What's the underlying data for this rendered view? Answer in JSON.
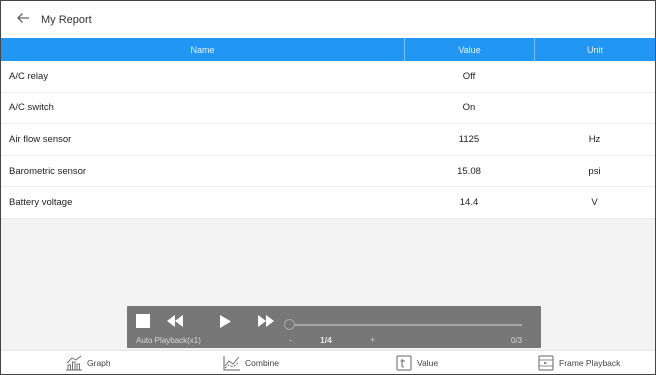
{
  "header": {
    "title": "My Report",
    "back_icon": "arrow-left-icon"
  },
  "table": {
    "columns": {
      "name": "Name",
      "value": "Value",
      "unit": "Unit"
    },
    "rows": [
      {
        "name": "A/C relay",
        "value": "Off",
        "unit": ""
      },
      {
        "name": "A/C switch",
        "value": "On",
        "unit": ""
      },
      {
        "name": "Air flow sensor",
        "value": "1125",
        "unit": "Hz"
      },
      {
        "name": "Barometric sensor",
        "value": "15.08",
        "unit": "psi"
      },
      {
        "name": "Battery voltage",
        "value": "14.4",
        "unit": "V"
      }
    ]
  },
  "player": {
    "auto_playback": "Auto Playback(x1)",
    "prev_page": "-",
    "next_page": "+",
    "page_indicator": "1/4",
    "frame_count": "0/3",
    "progress": 0,
    "icons": [
      "stop-icon",
      "rewind-icon",
      "play-icon",
      "fast-forward-icon"
    ]
  },
  "toolbar": {
    "graph": "Graph",
    "combine": "Combine",
    "value": "Value",
    "frame_playback": "Frame Playback"
  },
  "colors": {
    "header_blue": "#2196f3",
    "player_gray": "#777777",
    "background": "#f3f3f3"
  }
}
